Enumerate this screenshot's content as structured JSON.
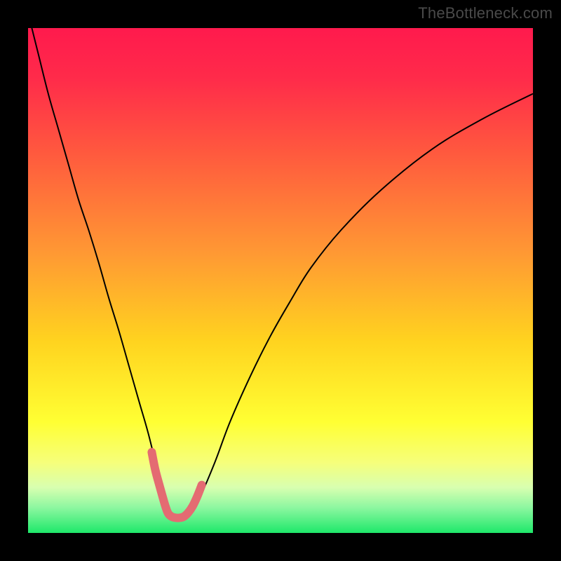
{
  "watermark": {
    "text": "TheBottleneck.com"
  },
  "chart_data": {
    "type": "line",
    "title": "",
    "xlabel": "",
    "ylabel": "",
    "xlim": [
      0,
      100
    ],
    "ylim": [
      0,
      100
    ],
    "grid": false,
    "legend": "none",
    "background_gradient": {
      "stops": [
        {
          "pct": 0,
          "color": "#ff1a4d"
        },
        {
          "pct": 10,
          "color": "#ff2b4a"
        },
        {
          "pct": 25,
          "color": "#ff5a3e"
        },
        {
          "pct": 45,
          "color": "#ff9a33"
        },
        {
          "pct": 62,
          "color": "#ffd31f"
        },
        {
          "pct": 78,
          "color": "#ffff33"
        },
        {
          "pct": 86,
          "color": "#f6ff7a"
        },
        {
          "pct": 91,
          "color": "#d8ffb0"
        },
        {
          "pct": 95,
          "color": "#8cf7a0"
        },
        {
          "pct": 100,
          "color": "#1ee86a"
        }
      ]
    },
    "series": [
      {
        "name": "bottleneck-curve",
        "color": "#000000",
        "thickness": 2,
        "x": [
          0,
          2,
          4,
          6,
          8,
          10,
          12,
          14,
          16,
          18,
          20,
          22,
          24,
          26,
          27,
          28,
          29,
          30,
          32,
          34,
          37,
          40,
          44,
          48,
          52,
          56,
          62,
          70,
          80,
          90,
          100
        ],
        "y": [
          103,
          95,
          87,
          80,
          73,
          66,
          60,
          53.5,
          46.5,
          40,
          33,
          26,
          19,
          10.5,
          6,
          3.5,
          3,
          3,
          3.5,
          7,
          14,
          22,
          31,
          39,
          46,
          52.5,
          60,
          68,
          76,
          82,
          87
        ]
      },
      {
        "name": "highlighted-minimum",
        "color": "#e46b72",
        "thickness": 12,
        "linecap": "round",
        "x": [
          24.5,
          25.2,
          26.0,
          26.7,
          27.3,
          27.8,
          28.5,
          29.3,
          30.0,
          30.8,
          31.7,
          32.6,
          33.5,
          34.4
        ],
        "y": [
          16.0,
          12.5,
          9.5,
          7.0,
          5.0,
          3.8,
          3.2,
          3.0,
          3.0,
          3.2,
          4.0,
          5.3,
          7.2,
          9.5
        ]
      }
    ]
  }
}
